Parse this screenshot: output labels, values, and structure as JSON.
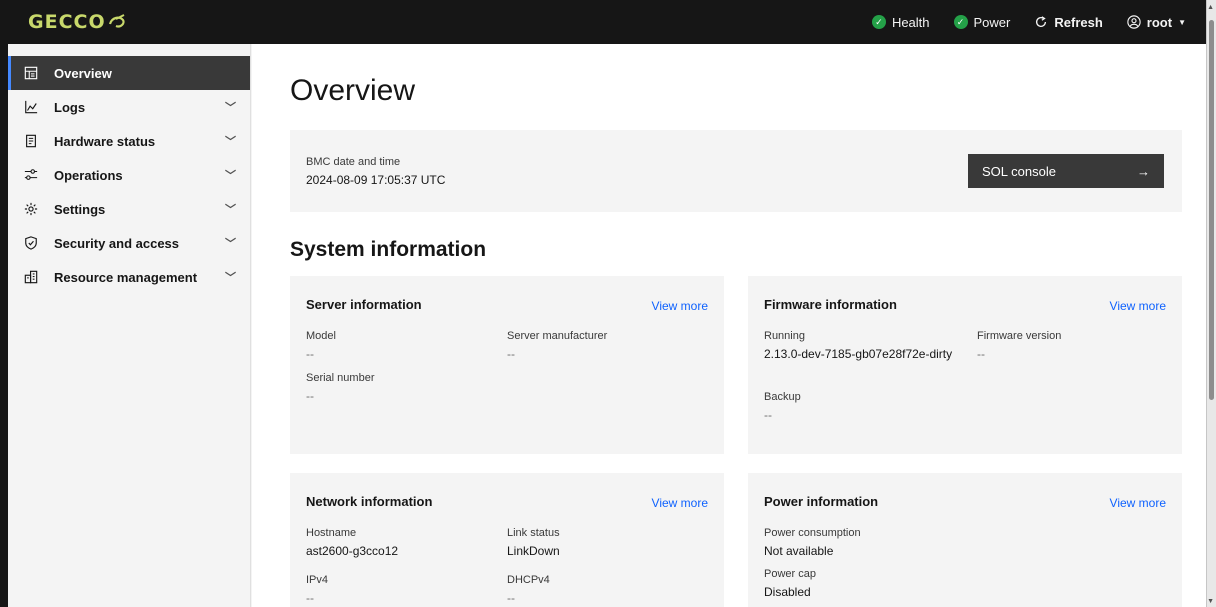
{
  "header": {
    "logo": "GECCO",
    "health_label": "Health",
    "power_label": "Power",
    "refresh_label": "Refresh",
    "user_label": "root"
  },
  "sidebar": {
    "items": [
      {
        "label": "Overview",
        "icon": "dashboard-icon",
        "active": true
      },
      {
        "label": "Logs",
        "icon": "chart-line-icon"
      },
      {
        "label": "Hardware status",
        "icon": "clipboard-list-icon"
      },
      {
        "label": "Operations",
        "icon": "sliders-icon"
      },
      {
        "label": "Settings",
        "icon": "gear-icon"
      },
      {
        "label": "Security and access",
        "icon": "shield-check-icon"
      },
      {
        "label": "Resource management",
        "icon": "building-icon"
      }
    ]
  },
  "main": {
    "title": "Overview",
    "bmc": {
      "label": "BMC date and time",
      "value": "2024-08-09 17:05:37 UTC"
    },
    "sol_console": "SOL console",
    "section_title": "System information",
    "view_more": "View more",
    "server": {
      "title": "Server information",
      "model_label": "Model",
      "model_value": "--",
      "manufacturer_label": "Server manufacturer",
      "manufacturer_value": "--",
      "serial_label": "Serial number",
      "serial_value": "--"
    },
    "firmware": {
      "title": "Firmware information",
      "running_label": "Running",
      "running_value": "2.13.0-dev-7185-gb07e28f72e-dirty",
      "version_label": "Firmware version",
      "version_value": "--",
      "backup_label": "Backup",
      "backup_value": "--"
    },
    "network": {
      "title": "Network information",
      "hostname_label": "Hostname",
      "hostname_value": "ast2600-g3cco12",
      "link_label": "Link status",
      "link_value": "LinkDown",
      "ipv4_label": "IPv4",
      "ipv4_value": "--",
      "dhcp_label": "DHCPv4",
      "dhcp_value": "--"
    },
    "power": {
      "title": "Power information",
      "consumption_label": "Power consumption",
      "consumption_value": "Not available",
      "cap_label": "Power cap",
      "cap_value": "Disabled"
    }
  },
  "colors": {
    "header_bg": "#161616",
    "status_ok": "#24a148",
    "link": "#0f62fe",
    "active_nav": "#393939",
    "accent": "#4589ff"
  }
}
